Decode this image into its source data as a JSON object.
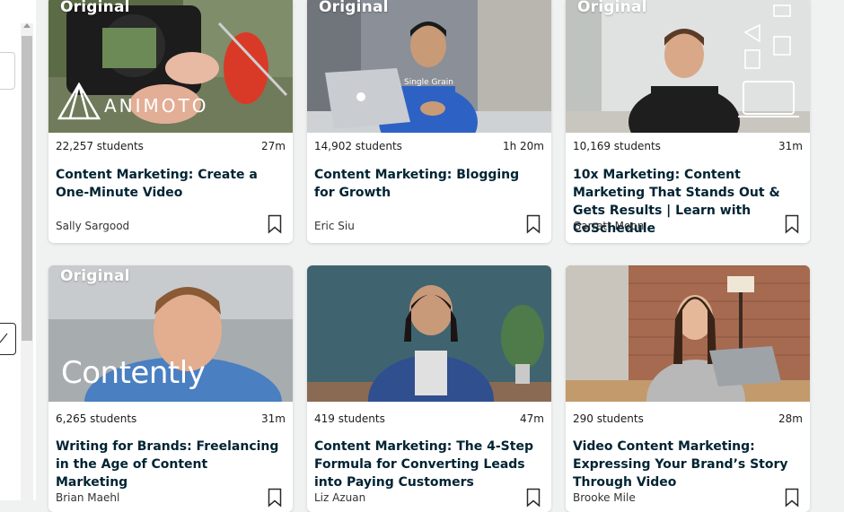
{
  "badge": "Original",
  "cards": [
    {
      "students": "22,257 students",
      "duration": "27m",
      "title": "Content Marketing: Create a One-Minute Video",
      "author": "Sally Sargood",
      "thumb_logo": "ANIMOTO"
    },
    {
      "students": "14,902 students",
      "duration": "1h 20m",
      "title": "Content Marketing: Blogging for Growth",
      "author": "Eric Siu",
      "thumb_logo": "Single Grain"
    },
    {
      "students": "10,169 students",
      "duration": "31m",
      "title": "10x Marketing: Content Marketing That Stands Out & Gets Results | Learn with CoSchedule",
      "author": "Garrett Moon"
    },
    {
      "students": "6,265 students",
      "duration": "31m",
      "title": "Writing for Brands: Freelancing in the Age of Content Marketing",
      "author": "Brian Maehl",
      "thumb_logo": "Contently"
    },
    {
      "students": "419 students",
      "duration": "47m",
      "title": "Content Marketing: The 4-Step Formula for Converting Leads into Paying Customers",
      "author": "Liz Azuan"
    },
    {
      "students": "290 students",
      "duration": "28m",
      "title": "Video Content Marketing: Expressing Your Brand’s Story Through Video",
      "author": "Brooke Mile"
    }
  ],
  "icons": {
    "bookmark": "bookmark-icon",
    "scroll_up": "chevron-up-icon",
    "edit": "pencil-icon"
  },
  "colors": {
    "accent": "#00d488",
    "title": "#002333"
  }
}
